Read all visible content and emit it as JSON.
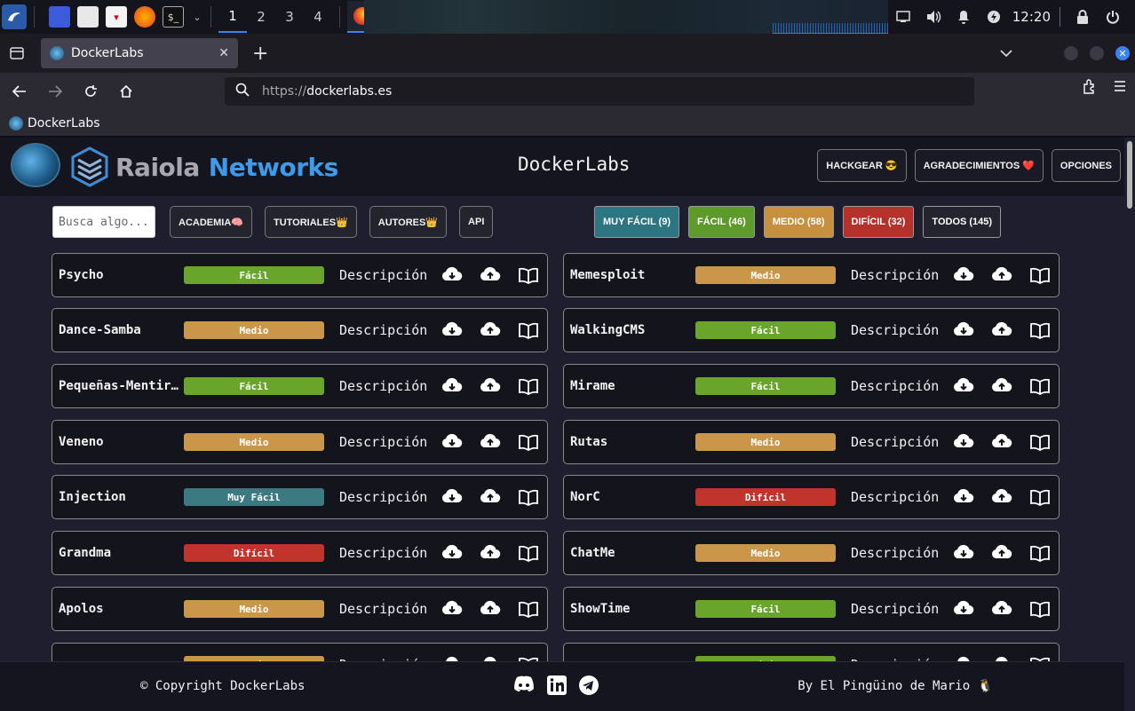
{
  "taskbar": {
    "workspaces": [
      "1",
      "2",
      "3",
      "4"
    ],
    "clock": "12:20"
  },
  "browser": {
    "tab_title": "DockerLabs",
    "url_scheme": "https://",
    "url_host": "dockerlabs.es",
    "bookmark": "DockerLabs"
  },
  "header": {
    "brand_word1": "Raiola",
    "brand_word2": "Networks",
    "site_title": "DockerLabs",
    "buttons": [
      "HACKGEAR 😎",
      "AGRADECIMIENTOS ❤️",
      "OPCIONES"
    ]
  },
  "toolbar": {
    "search_placeholder": "Busca algo...",
    "nav": [
      "ACADEMIA🧠",
      "TUTORIALES👑",
      "AUTORES👑",
      "API"
    ],
    "difficulty_filters": [
      {
        "label": "MUY FÁCIL (9)",
        "color": "#2e7582"
      },
      {
        "label": "FÁCIL (46)",
        "color": "#5e9a2b"
      },
      {
        "label": "MEDIO (58)",
        "color": "#c7903f"
      },
      {
        "label": "DIFÍCIL (32)",
        "color": "#b5322c"
      },
      {
        "label": "TODOS (145)",
        "color": "#24242f"
      }
    ]
  },
  "colors": {
    "Muy Fácil": "#3b7a80",
    "Fácil": "#6aa52b",
    "Medio": "#c9964a",
    "Difícil": "#c0342c"
  },
  "desc_label": "Descripción",
  "machines_left": [
    {
      "name": "Psycho",
      "level": "Fácil"
    },
    {
      "name": "Dance-Samba",
      "level": "Medio"
    },
    {
      "name": "Pequeñas-Mentirosas",
      "level": "Fácil"
    },
    {
      "name": "Veneno",
      "level": "Medio"
    },
    {
      "name": "Injection",
      "level": "Muy Fácil"
    },
    {
      "name": "Grandma",
      "level": "Difícil"
    },
    {
      "name": "Apolos",
      "level": "Medio"
    },
    {
      "name": "",
      "level": "Medio"
    }
  ],
  "machines_right": [
    {
      "name": "Memesploit",
      "level": "Medio"
    },
    {
      "name": "WalkingCMS",
      "level": "Fácil"
    },
    {
      "name": "Mirame",
      "level": "Fácil"
    },
    {
      "name": "Rutas",
      "level": "Medio"
    },
    {
      "name": "NorC",
      "level": "Difícil"
    },
    {
      "name": "ChatMe",
      "level": "Medio"
    },
    {
      "name": "ShowTime",
      "level": "Fácil"
    },
    {
      "name": "",
      "level": "Fácil"
    }
  ],
  "footer": {
    "copyright": "© Copyright DockerLabs",
    "byline": "By El Pingüino de Mario 🐧"
  }
}
